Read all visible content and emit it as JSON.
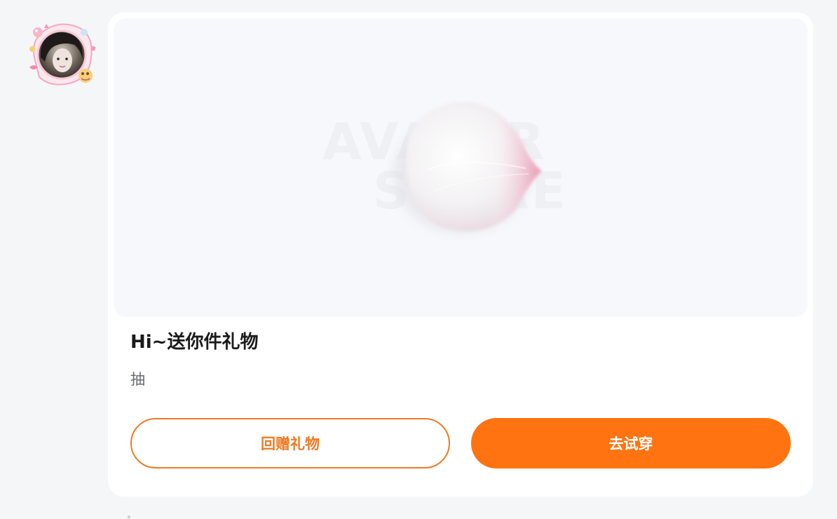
{
  "avatar": {
    "icon": "user-avatar-with-decorative-frame"
  },
  "gift_card": {
    "preview": {
      "watermark_line1": "AVATAR",
      "watermark_line2": "STORE",
      "item_icon": "pink-white-petal"
    },
    "title": "Hi~送你件礼物",
    "subtitle": "抽",
    "buttons": {
      "return_gift": "回赠礼物",
      "try_on": "去试穿"
    }
  },
  "colors": {
    "accent": "#ff7310",
    "accent_border": "#ef7a24",
    "background": "#f5f6f8",
    "card": "#ffffff"
  }
}
